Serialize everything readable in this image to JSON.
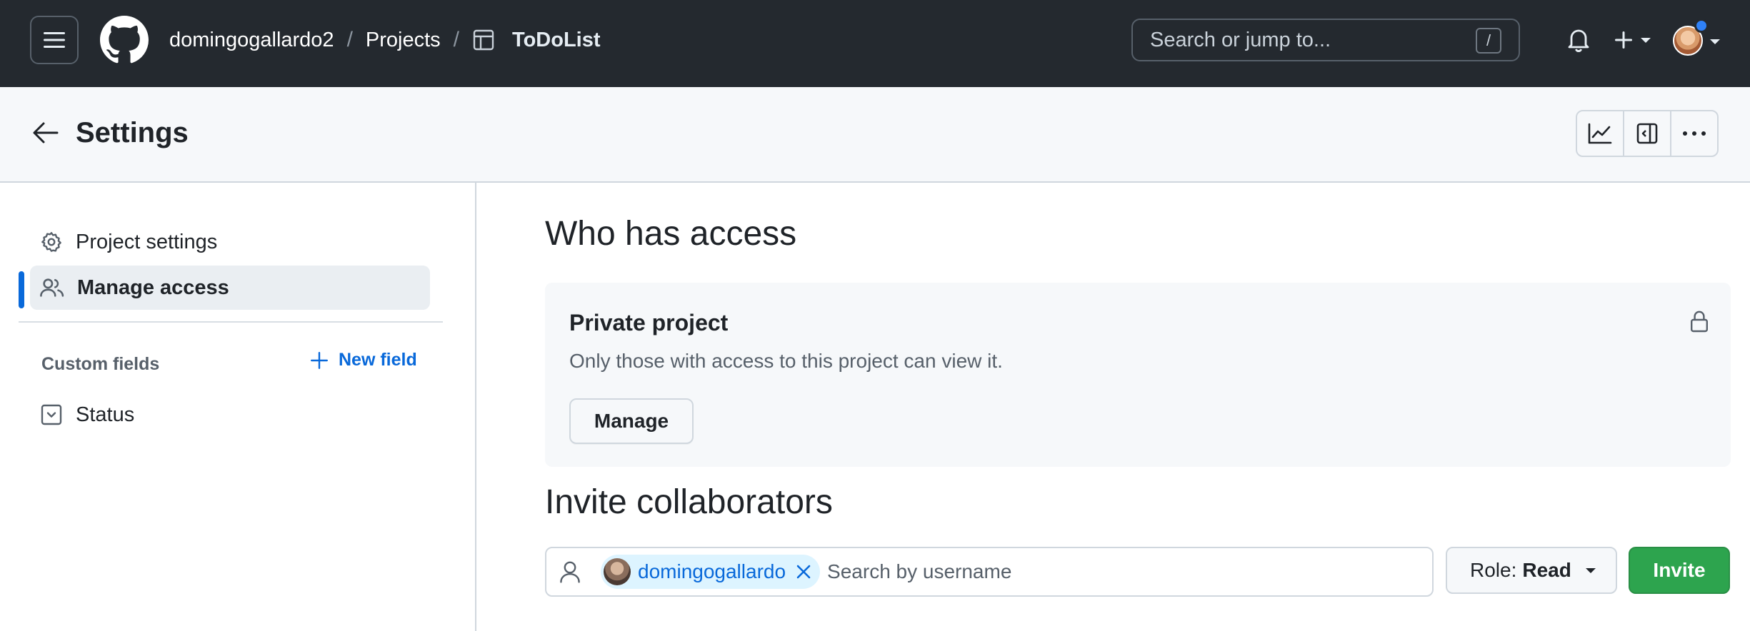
{
  "header": {
    "breadcrumbs": [
      "domingogallardo2",
      "Projects",
      "ToDoList"
    ],
    "separator": "/",
    "search_placeholder": "Search or jump to...",
    "search_shortcut": "/",
    "icons": [
      "hamburger-icon",
      "github-logo-icon",
      "table-icon",
      "bell-icon",
      "plus-icon",
      "chevron-down-icon",
      "avatar"
    ]
  },
  "settings_bar": {
    "title": "Settings",
    "icons": [
      "arrow-left-icon",
      "graph-icon",
      "sidebar-expand-icon",
      "kebab-horizontal-icon"
    ]
  },
  "sidebar": {
    "items": [
      {
        "label": "Project settings",
        "icon": "gear-icon",
        "active": false
      },
      {
        "label": "Manage access",
        "icon": "people-icon",
        "active": true
      }
    ],
    "custom_fields_label": "Custom fields",
    "new_field_label": "New field",
    "fields": [
      {
        "label": "Status",
        "icon": "single-select-icon"
      }
    ]
  },
  "main": {
    "access_heading": "Who has access",
    "private_box": {
      "title": "Private project",
      "description": "Only those with access to this project can view it.",
      "manage_label": "Manage"
    },
    "invite_heading": "Invite collaborators",
    "invite": {
      "chip_username": "domingogallardo",
      "placeholder": "Search by username",
      "role_prefix": "Role:",
      "role_value": "Read",
      "invite_label": "Invite"
    }
  },
  "colors": {
    "header_bg": "#24292f",
    "accent_blue": "#0969da",
    "invite_green": "#2da44e",
    "subtle_bg": "#f6f8fa",
    "border": "#d0d7de"
  }
}
